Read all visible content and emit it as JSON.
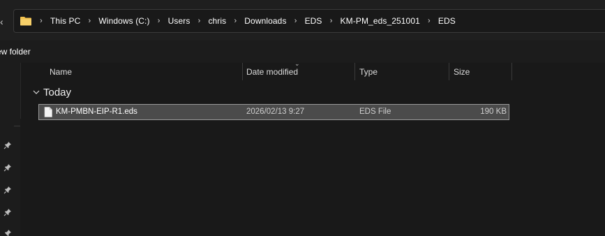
{
  "address_bar": {
    "crumbs": [
      "This PC",
      "Windows (C:)",
      "Users",
      "chris",
      "Downloads",
      "EDS",
      "KM-PM_eds_251001",
      "EDS"
    ]
  },
  "command_bar": {
    "new_folder_label": "ew folder"
  },
  "columns": {
    "name": "Name",
    "date_modified": "Date modified",
    "type": "Type",
    "size": "Size"
  },
  "group": {
    "label": "Today"
  },
  "files": [
    {
      "name": "KM-PMBN-EIP-R1.eds",
      "date_modified": "2026/02/13 9:27",
      "type": "EDS File",
      "size": "190 KB"
    }
  ],
  "colors": {
    "background": "#191919",
    "selection_fill": "#4b4b4b",
    "selection_border": "#9a9a9a",
    "folder_yellow": "#f2c14e"
  },
  "icons": {
    "folder": "folder-icon",
    "separator": "chevron-right-icon",
    "pin": "pin-icon",
    "file": "document-icon",
    "group_toggle": "chevron-down-icon"
  }
}
